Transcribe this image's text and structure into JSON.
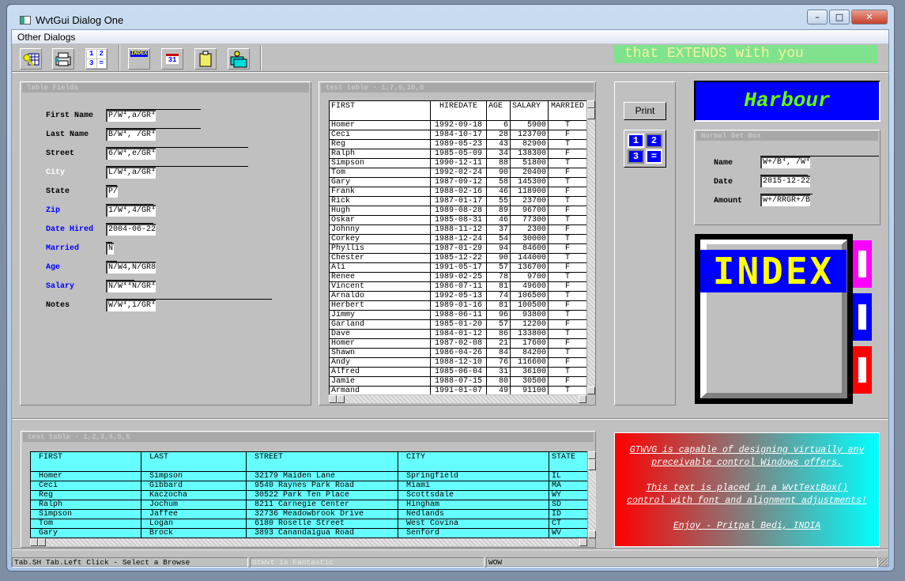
{
  "window": {
    "title": "WvtGui Dialog One",
    "min": "–",
    "max": "□",
    "close": "✕"
  },
  "menu": {
    "other_dialogs": "Other Dialogs"
  },
  "toolbar": {
    "icons": [
      "keys-grid-icon",
      "printer-icon",
      "calculator-icon",
      "index-icon",
      "calendar-icon",
      "clipboard-icon",
      "folders-icon"
    ],
    "calc_digits": [
      "1",
      "2",
      "3",
      "="
    ],
    "index_text": "INDEX",
    "cal_text": "31"
  },
  "banner": {
    "text": "that EXTENDS with you",
    "bg": "#80e28c",
    "fg": "#f4f4a0"
  },
  "table_fields": {
    "title": "Table Fields",
    "fields": [
      {
        "label": "First Name",
        "value": "P/W⁴,a/GR⁴",
        "color": "black",
        "line": 120
      },
      {
        "label": "Last Name",
        "value": "B/W⁴, /GR⁴",
        "color": "black",
        "line": 120
      },
      {
        "label": "Street",
        "value": "6/W⁴,e/GR⁴",
        "color": "black",
        "line": 180
      },
      {
        "label": "City",
        "value": "L/W⁴,a/GR⁴",
        "color": "white",
        "line": 180
      },
      {
        "label": "State",
        "value": "P/",
        "color": "black",
        "line": 14
      },
      {
        "label": "Zip",
        "value": "1/W⁴,4/GR⁴",
        "color": "blue",
        "line": 60
      },
      {
        "label": "Date Hired",
        "value": "2004-06-22",
        "color": "blue",
        "line": 60
      },
      {
        "label": "Married",
        "value": "N",
        "color": "blue",
        "line": 8
      },
      {
        "label": "Age",
        "value": "N/W4,N/GR8",
        "color": "blue",
        "line": 14
      },
      {
        "label": "Salary",
        "value": "N/W⁴⁴N/GR⁴",
        "color": "blue",
        "line": 36
      },
      {
        "label": "Notes",
        "value": "W/W⁴,i/GR⁴",
        "color": "black",
        "line": 210
      }
    ]
  },
  "table1": {
    "title": "test table - 1,7,9,10,8",
    "columns": [
      "FIRST",
      "HIREDATE",
      "AGE",
      "SALARY",
      "MARRIED"
    ],
    "rows": [
      [
        "Homer",
        "1992-09-18",
        "6",
        "5900",
        "T"
      ],
      [
        "Ceci",
        "1984-10-17",
        "28",
        "123700",
        "F"
      ],
      [
        "Reg",
        "1989-05-23",
        "43",
        "82900",
        "T"
      ],
      [
        "Ralph",
        "1985-05-09",
        "34",
        "138300",
        "F"
      ],
      [
        "Simpson",
        "1990-12-11",
        "88",
        "51800",
        "T"
      ],
      [
        "Tom",
        "1992-02-24",
        "90",
        "20400",
        "F"
      ],
      [
        "Gary",
        "1987-09-12",
        "58",
        "145300",
        "T"
      ],
      [
        "Frank",
        "1988-02-16",
        "46",
        "118900",
        "F"
      ],
      [
        "Rick",
        "1987-01-17",
        "55",
        "23700",
        "T"
      ],
      [
        "Hugh",
        "1989-08-28",
        "89",
        "96700",
        "F"
      ],
      [
        "Oskar",
        "1985-08-31",
        "46",
        "77300",
        "T"
      ],
      [
        "Johnny",
        "1988-11-12",
        "37",
        "2300",
        "F"
      ],
      [
        "Corkey",
        "1988-12-24",
        "54",
        "30000",
        "T"
      ],
      [
        "Phyllis",
        "1987-01-29",
        "94",
        "84600",
        "F"
      ],
      [
        "Chester",
        "1985-12-22",
        "90",
        "144000",
        "T"
      ],
      [
        "Ali",
        "1991-05-17",
        "57",
        "136700",
        "F"
      ],
      [
        "Renee",
        "1989-02-25",
        "78",
        "9700",
        "T"
      ],
      [
        "Vincent",
        "1986-07-11",
        "81",
        "49600",
        "F"
      ],
      [
        "Arnaldo",
        "1992-05-13",
        "74",
        "106500",
        "T"
      ],
      [
        "Herbert",
        "1989-01-16",
        "81",
        "100500",
        "F"
      ],
      [
        "Jimmy",
        "1988-06-11",
        "96",
        "93800",
        "T"
      ],
      [
        "Garland",
        "1985-01-20",
        "57",
        "12200",
        "F"
      ],
      [
        "Dave",
        "1984-01-12",
        "86",
        "133800",
        "T"
      ],
      [
        "Homer",
        "1987-02-08",
        "21",
        "17600",
        "F"
      ],
      [
        "Shawn",
        "1986-04-26",
        "84",
        "84200",
        "T"
      ],
      [
        "Andy",
        "1988-12-10",
        "76",
        "116600",
        "F"
      ],
      [
        "Alfred",
        "1985-06-04",
        "31",
        "36100",
        "T"
      ],
      [
        "Jamie",
        "1988-07-15",
        "80",
        "30500",
        "F"
      ],
      [
        "Armand",
        "1991-01-07",
        "49",
        "91100",
        "T"
      ]
    ]
  },
  "print_button": "Print",
  "harbour": {
    "text": "Harbour",
    "bg": "#0000ff",
    "fg": "#66ff00"
  },
  "get_box": {
    "title": "Normal Get Box",
    "fields": [
      {
        "label": "Name",
        "value": "W+/B⁴, /W⁴",
        "line": 150
      },
      {
        "label": "Date",
        "value": "2015-12-22",
        "line": 60
      },
      {
        "label": "Amount",
        "value": "w+/RRGR+/B",
        "line": 66
      }
    ]
  },
  "table2": {
    "title": "test table - 1,2,3,4,5,6",
    "columns": [
      "FIRST",
      "LAST",
      "STREET",
      "CITY",
      "STATE"
    ],
    "rows": [
      [
        "Homer",
        "Simpson",
        "32179 Maiden Lane",
        "Springfield",
        "IL"
      ],
      [
        "Ceci",
        "Gibbard",
        "9540 Raynes Park Road",
        "Miami",
        "MA"
      ],
      [
        "Reg",
        "Kaczocha",
        "30522 Park Ten Place",
        "Scottsdale",
        "WY"
      ],
      [
        "Ralph",
        "Jochum",
        "8211 Carnegie Center",
        "Hingham",
        "SD"
      ],
      [
        "Simpson",
        "Jaffee",
        "32736 Meadowbrook Drive",
        "Nedlands",
        "ID"
      ],
      [
        "Tom",
        "Logan",
        "6180 Roselle Street",
        "West Covina",
        "CT"
      ],
      [
        "Gary",
        "Brock",
        "3893 Canandaigua Road",
        "Senford",
        "WV"
      ]
    ]
  },
  "textbox": {
    "lines": [
      "GTWVG is capable of designing virtually any",
      "preceivable control Windows offers.",
      "",
      "This text is placed in a WvtTextBox()",
      "control with font and alignment adjustments!",
      "",
      "Enjoy - Pritpal Bedi, INDIA"
    ]
  },
  "status": {
    "s1": "Tab.SH Tab.Left Click - Select a Browse",
    "s2": "GtWvt is Fantastic",
    "s3": "WOW"
  }
}
